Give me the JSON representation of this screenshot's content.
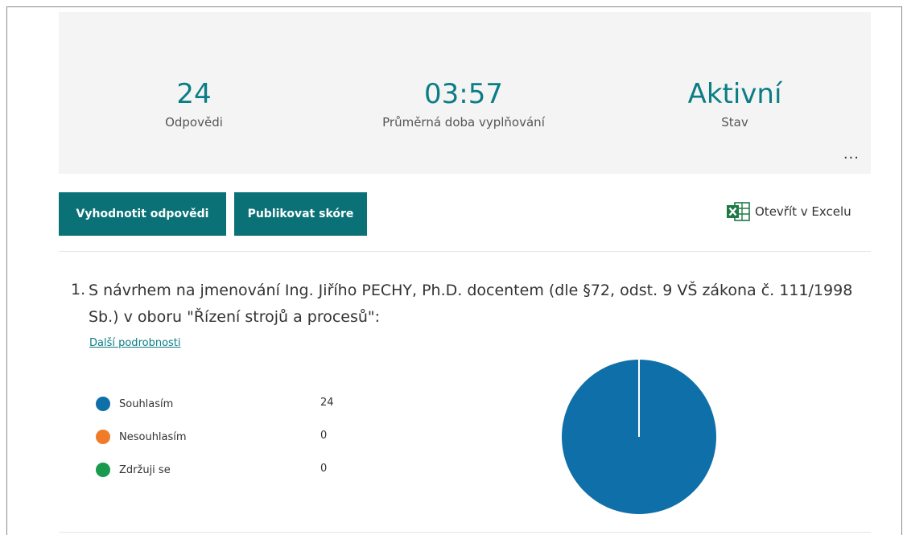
{
  "stats": {
    "responses": {
      "value": "24",
      "label": "Odpovědi"
    },
    "duration": {
      "value": "03:57",
      "label": "Průměrná doba vyplňování"
    },
    "status": {
      "value": "Aktivní",
      "label": "Stav"
    },
    "more_label": "..."
  },
  "actions": {
    "review_label": "Vyhodnotit odpovědi",
    "publish_label": "Publikovat skóre",
    "excel_label": "Otevřít v Excelu",
    "excel_icon": "excel-icon"
  },
  "question": {
    "number": "1.",
    "text": "S návrhem na jmenování Ing. Jiřího PECHY, Ph.D. docentem (dle §72, odst. 9 VŠ zákona č. 111/1998 Sb.) v oboru \"Řízení strojů a procesů\":",
    "details_link": "Další podrobnosti"
  },
  "chart_data": {
    "type": "pie",
    "categories": [
      "Souhlasím",
      "Nesouhlasím",
      "Zdržuji se"
    ],
    "values": [
      24,
      0,
      0
    ],
    "colors": [
      "#0f6fa8",
      "#f07c2a",
      "#199a4d"
    ]
  }
}
